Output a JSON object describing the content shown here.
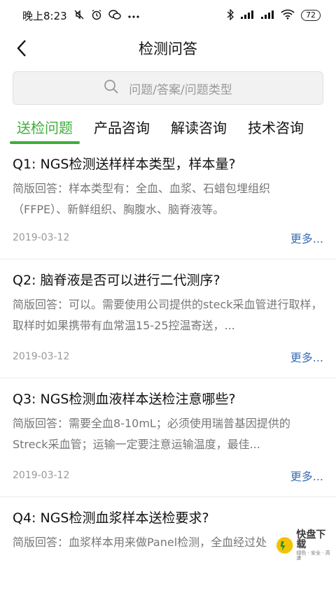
{
  "status_bar": {
    "time": "晚上8:23",
    "icons_left": [
      "mute-icon",
      "alarm-icon",
      "wechat-icon",
      "more-icon"
    ],
    "icons_right": [
      "bluetooth-icon",
      "signal-icon",
      "signal-icon",
      "wifi-icon"
    ],
    "battery": "72"
  },
  "nav": {
    "title": "检测问答"
  },
  "search": {
    "placeholder": "问题/答案/问题类型"
  },
  "tabs": [
    {
      "label": "送检问题",
      "active": true
    },
    {
      "label": "产品咨询",
      "active": false
    },
    {
      "label": "解读咨询",
      "active": false
    },
    {
      "label": "技术咨询",
      "active": false
    }
  ],
  "qa_items": [
    {
      "question": "Q1: NGS检测送样样本类型，样本量?",
      "answer": "简版回答：样本类型有：全血、血浆、石蜡包埋组织（FFPE）、新鲜组织、胸腹水、脑脊液等。",
      "date": "2019-03-12",
      "more": "更多..."
    },
    {
      "question": "Q2: 脑脊液是否可以进行二代测序?",
      "answer": "简版回答：可以。需要使用公司提供的steck采血管进行取样，取样时如果携带有血常温15-25控温寄送，...",
      "date": "2019-03-12",
      "more": "更多..."
    },
    {
      "question": "Q3: NGS检测血液样本送检注意哪些?",
      "answer": "简版回答：需要全血8-10mL；必须使用瑞普基因提供的Streck采血管；运输一定要注意运输温度，最佳...",
      "date": "2019-03-12",
      "more": "更多..."
    },
    {
      "question": "Q4: NGS检测血浆样本送检要求?",
      "answer": "简版回答：血浆样本用来做Panel检测，全血经过处",
      "date": "",
      "more": ""
    }
  ],
  "watermark": {
    "main": "快盘下载",
    "sub": "绿色 · 安全 · 高速"
  },
  "colors": {
    "accent": "#3fae3a",
    "link": "#3a6fb5"
  }
}
